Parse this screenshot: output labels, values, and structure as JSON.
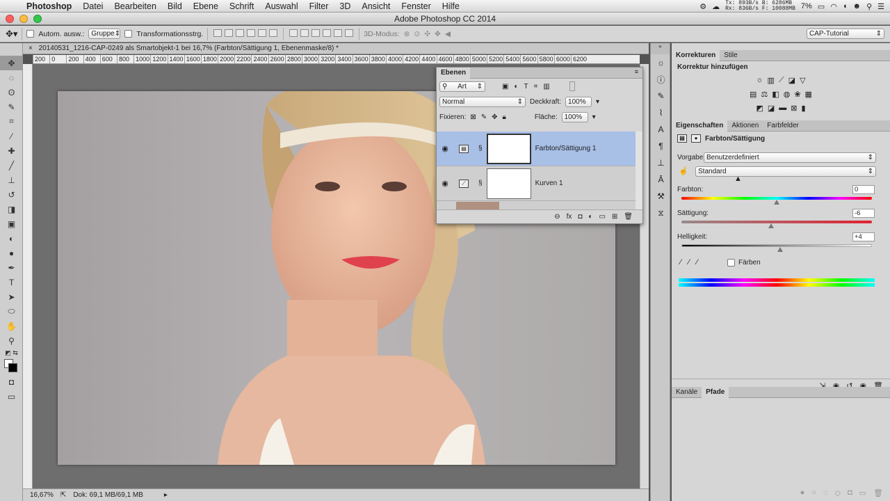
{
  "menubar": {
    "app": "Photoshop",
    "items": [
      "Datei",
      "Bearbeiten",
      "Bild",
      "Ebene",
      "Schrift",
      "Auswahl",
      "Filter",
      "3D",
      "Ansicht",
      "Fenster",
      "Hilfe"
    ],
    "net_tx": "Tx: 893B/s  B: 6286MB",
    "net_rx": "Rx: 836B/s  F: 10088MB",
    "battery": "7%"
  },
  "window": {
    "title": "Adobe Photoshop CC 2014"
  },
  "options": {
    "auto_select_label": "Autom. ausw.:",
    "auto_select_value": "Gruppe",
    "transform_label": "Transformationsstrg.",
    "mode3d_label": "3D-Modus:",
    "workspace": "CAP-Tutorial"
  },
  "document": {
    "tab_title": "20140531_1216-CAP-0249 als Smartobjekt-1 bei 16,7% (Farbton/Sättigung 1, Ebenenmaske/8) *",
    "ruler_ticks": [
      "200",
      "0",
      "200",
      "400",
      "600",
      "800",
      "1000",
      "1200",
      "1400",
      "1600",
      "1800",
      "2000",
      "2200",
      "2400",
      "2600",
      "2800",
      "3000",
      "3200",
      "3400",
      "3600",
      "3800",
      "4000",
      "4200",
      "4400",
      "4600",
      "4800",
      "5000",
      "5200",
      "5400",
      "5600",
      "5800",
      "6000",
      "6200"
    ],
    "zoom": "16,67%",
    "doc_info": "Dok: 69,1 MB/69,1 MB"
  },
  "layers_panel": {
    "tab": "Ebenen",
    "filter": "Art",
    "blend_mode": "Normal",
    "opacity_label": "Deckkraft:",
    "opacity_value": "100%",
    "lock_label": "Fixieren:",
    "fill_label": "Fläche:",
    "fill_value": "100%",
    "layers": [
      {
        "name": "Farbton/Sättigung 1",
        "selected": true
      },
      {
        "name": "Kurven 1",
        "selected": false
      }
    ]
  },
  "right_panel": {
    "tabs_top": [
      "Korrekturen",
      "Stile"
    ],
    "adjust_heading": "Korrektur hinzufügen",
    "tabs_props": [
      "Eigenschaften",
      "Aktionen",
      "Farbfelder"
    ],
    "props_title": "Farbton/Sättigung",
    "preset_label": "Vorgabe:",
    "preset_value": "Benutzerdefiniert",
    "channel_value": "Standard",
    "hue_label": "Farbton:",
    "hue_value": "0",
    "hue_level": 0.5,
    "sat_label": "Sättigung:",
    "sat_value": "-6",
    "sat_level": 0.47,
    "light_label": "Helligkeit:",
    "light_value": "+4",
    "light_level": 0.52,
    "colorize_label": "Färben",
    "tabs_bottom": [
      "Kanäle",
      "Pfade"
    ]
  },
  "colors": {
    "selected_layer": "#a8bfe6",
    "panel_bg": "#d6d6d6",
    "canvas_bg": "#6e6e6e"
  }
}
